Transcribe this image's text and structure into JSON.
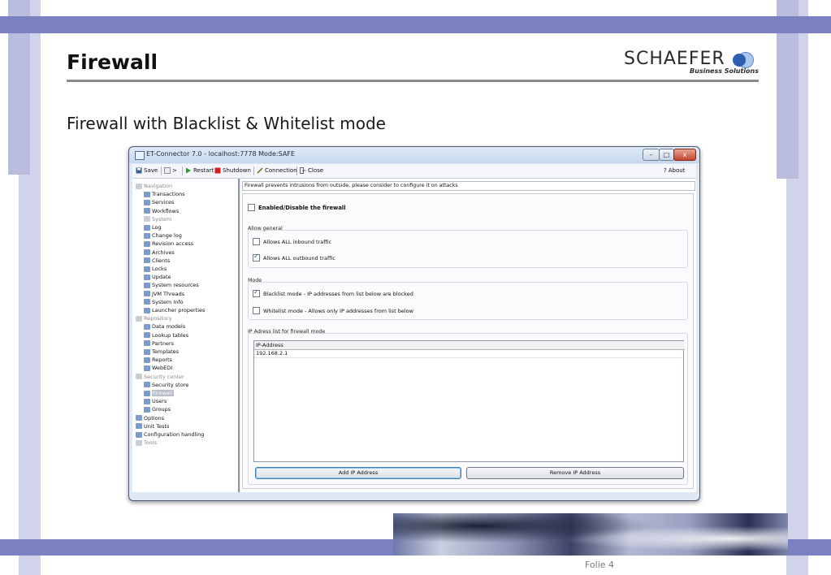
{
  "slide": {
    "title": "Firewall",
    "subtitle": "Firewall with Blacklist & Whitelist mode",
    "logo_main": "SCHAEFER",
    "logo_sub": "Business Solutions",
    "footer": "Folie 4",
    "colors": {
      "band": "#7b80c0",
      "side_bar": "#c3c5e2"
    }
  },
  "window": {
    "title": "ET-Connector 7.0 - localhost:7778 Mode:SAFE",
    "controls": {
      "minimize": "–",
      "maximize": "□",
      "close": "x"
    }
  },
  "toolbar": {
    "save": "Save",
    "console": ">",
    "restart": "Restart",
    "shutdown": "Shutdown",
    "connection": "Connection",
    "close": "Close",
    "help": "?",
    "about": "About"
  },
  "tree": [
    {
      "label": "Navigation",
      "icon": "home-icon",
      "grey": true
    },
    {
      "label": "Transactions",
      "icon": "transactions-icon"
    },
    {
      "label": "Services",
      "icon": "services-icon"
    },
    {
      "label": "Workflows",
      "icon": "workflows-icon"
    },
    {
      "label": "System",
      "icon": "system-icon",
      "grey": true
    },
    {
      "label": "Log",
      "icon": "log-icon"
    },
    {
      "label": "Change log",
      "icon": "changelog-icon"
    },
    {
      "label": "Revision access",
      "icon": "revision-icon"
    },
    {
      "label": "Archives",
      "icon": "archives-icon"
    },
    {
      "label": "Clients",
      "icon": "clients-icon"
    },
    {
      "label": "Locks",
      "icon": "locks-icon"
    },
    {
      "label": "Update",
      "icon": "info-icon"
    },
    {
      "label": "System resources",
      "icon": "resources-icon"
    },
    {
      "label": "JVM Threads",
      "icon": "info-icon"
    },
    {
      "label": "System Info",
      "icon": "info-icon"
    },
    {
      "label": "Launcher properties",
      "icon": "info-icon"
    },
    {
      "label": "Repository",
      "icon": "repository-icon",
      "grey": true
    },
    {
      "label": "Data models",
      "icon": "datamodels-icon"
    },
    {
      "label": "Lookup tables",
      "icon": "lookup-icon"
    },
    {
      "label": "Partners",
      "icon": "partners-icon"
    },
    {
      "label": "Templates",
      "icon": "templates-icon"
    },
    {
      "label": "Reports",
      "icon": "reports-icon"
    },
    {
      "label": "WebEDI",
      "icon": "webedi-icon"
    },
    {
      "label": "Security center",
      "icon": "security-icon",
      "grey": true
    },
    {
      "label": "Security store",
      "icon": "store-icon"
    },
    {
      "label": "Firewall",
      "icon": "firewall-icon",
      "selected": true
    },
    {
      "label": "Users",
      "icon": "users-icon"
    },
    {
      "label": "Groups",
      "icon": "groups-icon"
    },
    {
      "label": "Options",
      "icon": "options-icon"
    },
    {
      "label": "Unit Tests",
      "icon": "unittests-icon"
    },
    {
      "label": "Configuration handling",
      "icon": "config-icon"
    },
    {
      "label": "Tools",
      "icon": "tools-icon",
      "grey": true
    }
  ],
  "firewall": {
    "info": "Firewall prevents intrusions from outside, please consider to configure it on attacks",
    "enable_label": "Enabled/Disable the firewall",
    "enable_checked": false,
    "allow_general": {
      "title": "Allow general",
      "inbound_label": "Allows ALL inbound traffic",
      "inbound_checked": false,
      "outbound_label": "Allows ALL outbound traffic",
      "outbound_checked": true
    },
    "mode": {
      "title": "Mode",
      "blacklist_label": "Blacklist mode - IP addresses from list below are blocked",
      "blacklist_checked": true,
      "whitelist_label": "Whitelist mode - Allows only IP addresses from list below",
      "whitelist_checked": false
    },
    "ip_list": {
      "title": "IP Adress list for firewall mode",
      "column": "IP-Address",
      "rows": [
        "192.168.2.1"
      ]
    },
    "add_button": "Add IP Address",
    "remove_button": "Remove IP Address"
  }
}
